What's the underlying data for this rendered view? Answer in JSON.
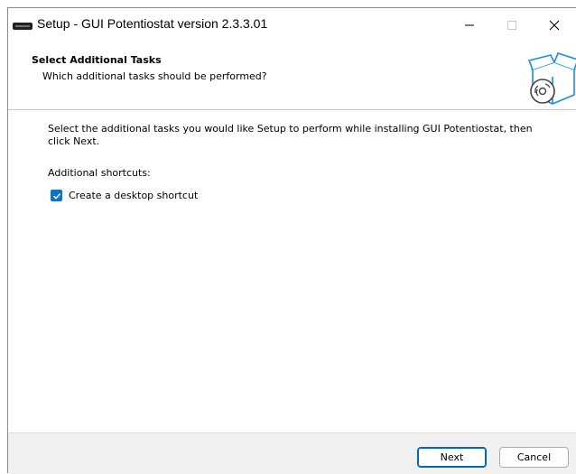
{
  "window": {
    "title": "Setup - GUI Potentiostat version 2.3.3.01"
  },
  "header": {
    "title": "Select Additional Tasks",
    "subtitle": "Which additional tasks should be performed?"
  },
  "content": {
    "intro": "Select the additional tasks you would like Setup to perform while installing GUI Potentiostat, then click Next.",
    "shortcuts_label": "Additional shortcuts:",
    "task_label": "Create a desktop shortcut",
    "task_checked": true
  },
  "footer": {
    "next_label": "Next",
    "cancel_label": "Cancel"
  },
  "colors": {
    "accent": "#1570c4",
    "footer_bg": "#f0f0f0"
  },
  "icons": {
    "app": "installer-icon",
    "header": "software-box-cd-icon"
  }
}
